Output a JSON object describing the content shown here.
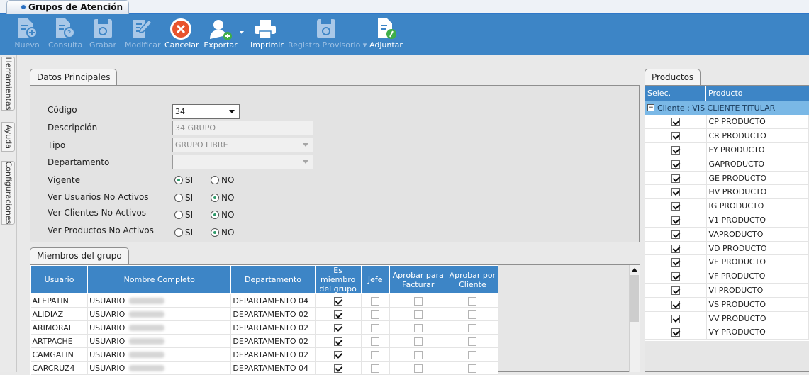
{
  "window": {
    "tab_title": "Grupos de Atención"
  },
  "toolbar": {
    "buttons": [
      {
        "label": "Nuevo",
        "icon": "document-add-icon",
        "enabled": false
      },
      {
        "label": "Consulta",
        "icon": "document-search-icon",
        "enabled": false
      },
      {
        "label": "Grabar",
        "icon": "save-icon",
        "enabled": false
      },
      {
        "label": "Modificar",
        "icon": "edit-icon",
        "enabled": false
      },
      {
        "label": "Cancelar",
        "icon": "cancel-icon",
        "enabled": true
      },
      {
        "label": "Exportar",
        "icon": "user-export-icon",
        "enabled": true
      },
      {
        "label": "Imprimir",
        "icon": "printer-icon",
        "enabled": true
      },
      {
        "label": "Registro Provisorio",
        "icon": "save-icon",
        "enabled": false
      },
      {
        "label": "Adjuntar",
        "icon": "attach-icon",
        "enabled": true
      }
    ]
  },
  "side_tabs": [
    "Herramientas",
    "Ayuda",
    "Configuraciones"
  ],
  "datos_principales": {
    "tab": "Datos Principales",
    "codigo_label": "Código",
    "codigo_value": "34",
    "descripcion_label": "Descripción",
    "descripcion_value": "34 GRUPO",
    "tipo_label": "Tipo",
    "tipo_value": "GRUPO LIBRE",
    "departamento_label": "Departamento",
    "departamento_value": "",
    "vigente_label": "Vigente",
    "ver_usuarios_label": "Ver Usuarios No Activos",
    "ver_clientes_label": "Ver Clientes No Activos",
    "ver_productos_label": "Ver Productos No Activos",
    "si": "SI",
    "no": "NO",
    "vigente": "SI",
    "ver_usuarios": "NO",
    "ver_clientes": "NO",
    "ver_productos": "NO"
  },
  "miembros": {
    "tab": "Miembros del grupo",
    "columns": [
      "Usuario",
      "Nombre Completo",
      "Departamento",
      "Es miembro del grupo",
      "Jefe",
      "Aprobar para Facturar",
      "Aprobar por Cliente"
    ],
    "rows": [
      {
        "usuario": "ALEPATIN",
        "nombre": "USUARIO",
        "departamento": "DEPARTAMENTO 04",
        "miembro": true,
        "jefe": false,
        "facturar": false,
        "cliente": false
      },
      {
        "usuario": "ALIDIAZ",
        "nombre": "USUARIO",
        "departamento": "DEPARTAMENTO 02",
        "miembro": true,
        "jefe": false,
        "facturar": false,
        "cliente": false
      },
      {
        "usuario": "ARIMORAL",
        "nombre": "USUARIO",
        "departamento": "DEPARTAMENTO 02",
        "miembro": true,
        "jefe": false,
        "facturar": false,
        "cliente": false
      },
      {
        "usuario": "ARTPACHE",
        "nombre": "USUARIO",
        "departamento": "DEPARTAMENTO 02",
        "miembro": true,
        "jefe": false,
        "facturar": false,
        "cliente": false
      },
      {
        "usuario": "CAMGALIN",
        "nombre": "USUARIO",
        "departamento": "DEPARTAMENTO 02",
        "miembro": true,
        "jefe": false,
        "facturar": false,
        "cliente": false
      },
      {
        "usuario": "CARCRUZ4",
        "nombre": "USUARIO",
        "departamento": "DEPARTAMENTO 04",
        "miembro": true,
        "jefe": false,
        "facturar": false,
        "cliente": false
      }
    ]
  },
  "productos": {
    "tab": "Productos",
    "columns": [
      "Selec.",
      "Producto"
    ],
    "group_label": "Cliente : VIS CLIENTE TITULAR",
    "collapse_symbol": "−",
    "rows": [
      "CP PRODUCTO",
      "CR PRODUCTO",
      "FY PRODUCTO",
      "GAPRODUCTO",
      "GE PRODUCTO",
      "HV PRODUCTO",
      "IG PRODUCTO",
      "V1 PRODUCTO",
      "VAPRODUCTO",
      "VD PRODUCTO",
      "VE PRODUCTO",
      "VF PRODUCTO",
      "VI PRODUCTO",
      "VS PRODUCTO",
      "VV PRODUCTO",
      "VY PRODUCTO"
    ]
  },
  "colors": {
    "toolbar": "#3d85c6",
    "header": "#3d85c6",
    "group_row": "#7ab8e6",
    "cancel": "#e8532d"
  }
}
